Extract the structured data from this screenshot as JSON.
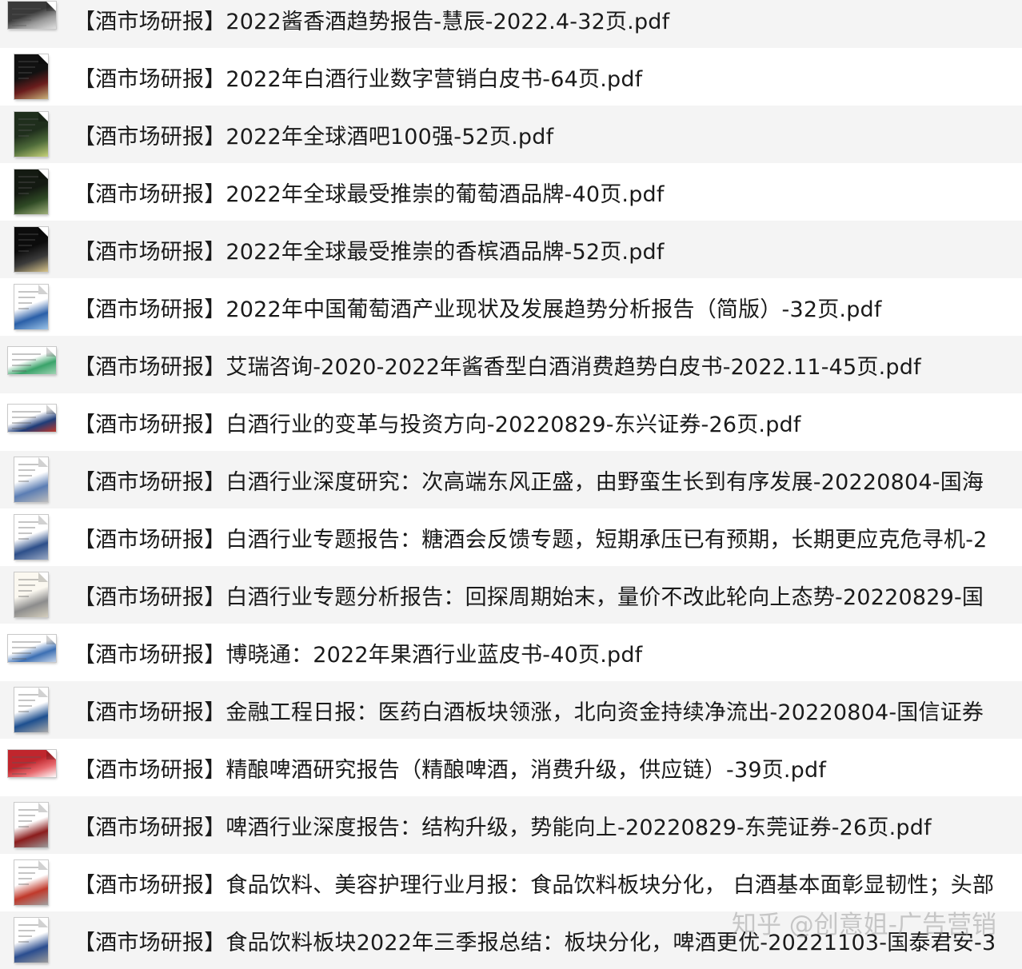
{
  "files": [
    {
      "name": "【酒市场研报】2022酱香酒趋势报告-慧辰-2022.4-32页.pdf",
      "thumb": "landscape",
      "colors": [
        "#3a3a3a",
        "#9a9a9a",
        "#e0e0e0"
      ]
    },
    {
      "name": "【酒市场研报】2022年白酒行业数字营销白皮书-64页.pdf",
      "thumb": "portrait",
      "colors": [
        "#111111",
        "#6b1d1d",
        "#c9b27a"
      ]
    },
    {
      "name": "【酒市场研报】2022年全球酒吧100强-52页.pdf",
      "thumb": "portrait",
      "colors": [
        "#1f2e1c",
        "#4e6b3a",
        "#c7d37a"
      ]
    },
    {
      "name": "【酒市场研报】2022年全球最受推崇的葡萄酒品牌-40页.pdf",
      "thumb": "portrait",
      "colors": [
        "#141a12",
        "#2f4a25",
        "#9fb07a"
      ]
    },
    {
      "name": "【酒市场研报】2022年全球最受推崇的香槟酒品牌-52页.pdf",
      "thumb": "portrait",
      "colors": [
        "#0c0c0c",
        "#3b3b3b",
        "#d9c58b"
      ]
    },
    {
      "name": "【酒市场研报】2022年中国葡萄酒产业现状及发展趋势分析报告（简版）-32页.pdf",
      "thumb": "portrait",
      "colors": [
        "#ffffff",
        "#2a5fa8",
        "#9cc4e8"
      ]
    },
    {
      "name": "【酒市场研报】艾瑞咨询-2020-2022年酱香型白酒消费趋势白皮书-2022.11-45页.pdf",
      "thumb": "landscape",
      "colors": [
        "#ffffff",
        "#3aa36a",
        "#9fd4b3"
      ]
    },
    {
      "name": "【酒市场研报】白酒行业的变革与投资方向-20220829-东兴证券-26页.pdf",
      "thumb": "landscape",
      "colors": [
        "#ffffff",
        "#1e3c78",
        "#c0392b"
      ]
    },
    {
      "name": "【酒市场研报】白酒行业深度研究：次高端东风正盛，由野蛮生长到有序发展-20220804-国海",
      "thumb": "portrait",
      "colors": [
        "#ffffff",
        "#5b7db3",
        "#bcbcbc"
      ]
    },
    {
      "name": "【酒市场研报】白酒行业专题报告：糖酒会反馈专题，短期承压已有预期，长期更应克危寻机-2",
      "thumb": "portrait",
      "colors": [
        "#ffffff",
        "#2d4f8a",
        "#9aa9c4"
      ]
    },
    {
      "name": "【酒市场研报】白酒行业专题分析报告：回探周期始末，量价不改此轮向上态势-20220829-国",
      "thumb": "portrait",
      "colors": [
        "#fbf8f0",
        "#8c8c8c",
        "#d6d0bf"
      ]
    },
    {
      "name": "【酒市场研报】博晓通：2022年果酒行业蓝皮书-40页.pdf",
      "thumb": "landscape",
      "colors": [
        "#ffffff",
        "#3c6fb3",
        "#c8d6ea"
      ]
    },
    {
      "name": "【酒市场研报】金融工程日报：医药白酒板块领涨，北向资金持续净流出-20220804-国信证券",
      "thumb": "portrait",
      "colors": [
        "#ffffff",
        "#1d4f8f",
        "#a9a9a9"
      ]
    },
    {
      "name": "【酒市场研报】精酿啤酒研究报告（精酿啤酒，消费升级，供应链）-39页.pdf",
      "thumb": "landscape",
      "colors": [
        "#c0262d",
        "#e86a6f",
        "#ffffff"
      ]
    },
    {
      "name": "【酒市场研报】啤酒行业深度报告：结构升级，势能向上-20220829-东莞证券-26页.pdf",
      "thumb": "portrait",
      "colors": [
        "#ffffff",
        "#8b1c1c",
        "#9a9a9a"
      ]
    },
    {
      "name": "【酒市场研报】食品饮料、美容护理行业月报：食品饮料板块分化， 白酒基本面彰显韧性；头部",
      "thumb": "portrait",
      "colors": [
        "#ffffff",
        "#c0392b",
        "#a0a0a0"
      ]
    },
    {
      "name": "【酒市场研报】食品饮料板块2022年三季报总结：板块分化，啤酒更优-20221103-国泰君安-3",
      "thumb": "portrait",
      "colors": [
        "#ffffff",
        "#2a4d8f",
        "#9a9a9a"
      ]
    }
  ],
  "watermark": "知乎 @创意姐-广告营销"
}
